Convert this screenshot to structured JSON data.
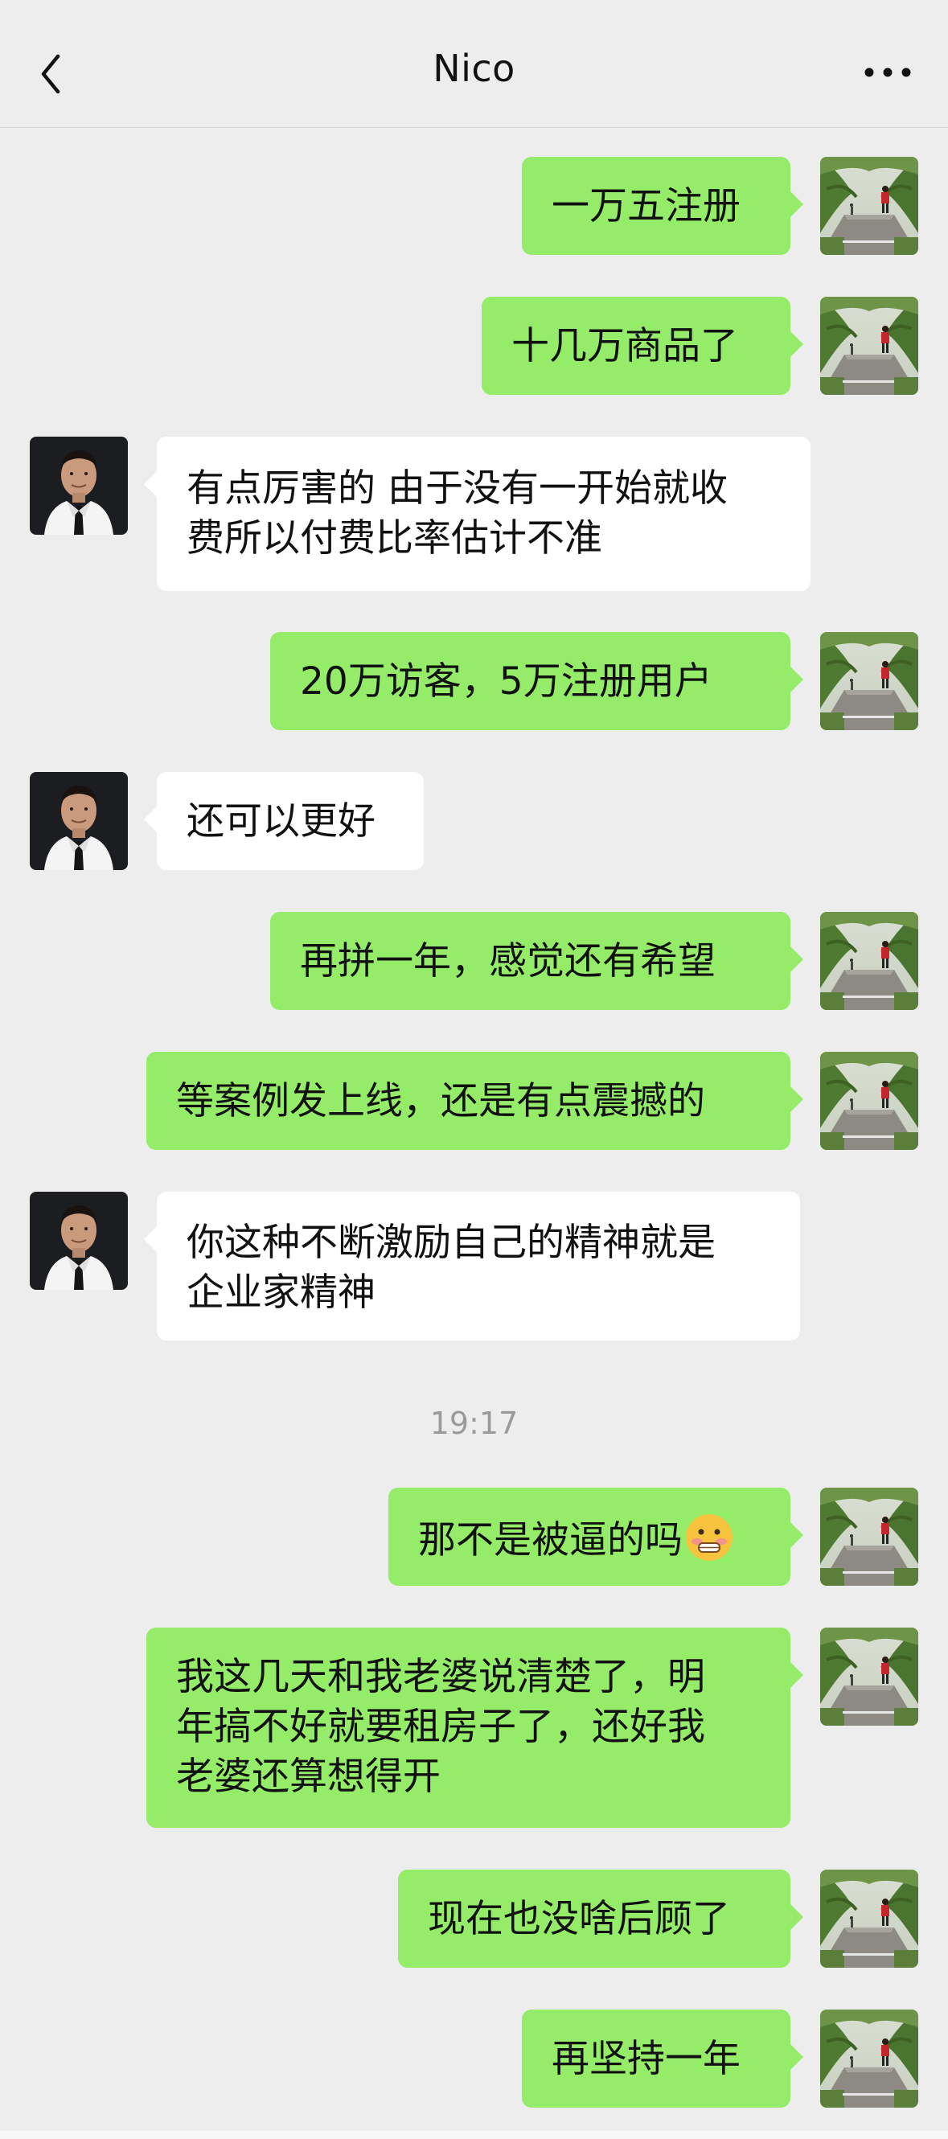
{
  "header": {
    "title": "Nico"
  },
  "timestamp": "19:17",
  "messages": [
    {
      "from": "me",
      "text": "一万五注册"
    },
    {
      "from": "me",
      "text": "十几万商品了"
    },
    {
      "from": "nico",
      "line1": "有点厉害的 由于没有一开始就收",
      "line2": "费所以付费比率估计不准"
    },
    {
      "from": "me",
      "text": "20万访客，5万注册用户"
    },
    {
      "from": "nico",
      "text": "还可以更好"
    },
    {
      "from": "me",
      "text": "再拼一年，感觉还有希望"
    },
    {
      "from": "me",
      "text": "等案例发上线，还是有点震撼的"
    },
    {
      "from": "nico",
      "line1": "你这种不断激励自己的精神就是",
      "line2": "企业家精神"
    },
    {
      "from": "me",
      "text": "那不是被逼的吗",
      "emoji": "grimacing-blush-emoji"
    },
    {
      "from": "me",
      "line1": "我这几天和我老婆说清楚了，明",
      "line2": "年搞不好就要租房子了，还好我",
      "line3": "老婆还算想得开"
    },
    {
      "from": "me",
      "text": "现在也没啥后顾了"
    },
    {
      "from": "me",
      "text": "再坚持一年"
    }
  ],
  "colors": {
    "sent_bubble": "#95ec69",
    "received_bubble": "#ffffff",
    "background": "#ededed"
  },
  "icons": {
    "back": "chevron-left-icon",
    "more": "more-dots-icon"
  }
}
